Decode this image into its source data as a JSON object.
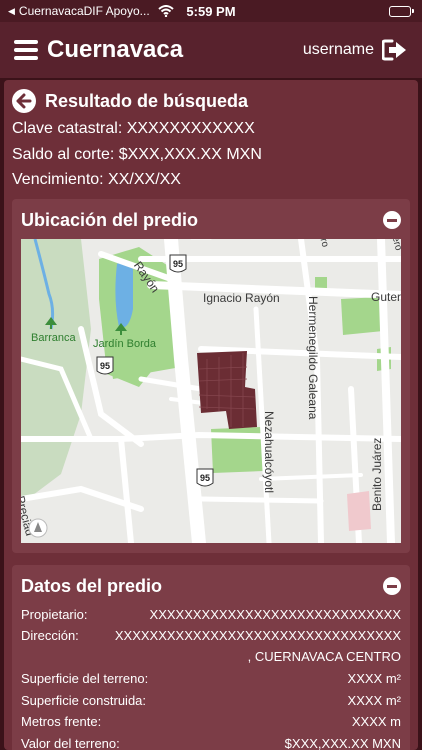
{
  "status_bar": {
    "back_app": "CuernavacaDIF Apoyo...",
    "time": "5:59 PM"
  },
  "header": {
    "title": "Cuernavaca",
    "username": "username"
  },
  "search": {
    "title": "Resultado de búsqueda",
    "clave": "Clave catastral: XXXXXXXXXXXX",
    "saldo": "Saldo al corte: $XXX,XXX.XX MXN",
    "vencimiento": "Vencimiento: XX/XX/XX"
  },
  "ubicacion": {
    "title": "Ubicación del predio",
    "map_labels": {
      "rayon_diag": "Rayón",
      "ignacio": "Ignacio Rayón",
      "guter": "Guter",
      "barranca": "Barranca",
      "jardin": "Jardín Borda",
      "hermenegildo": "Hermenegildo Galeana",
      "nezahualcoyotl": "Nezahualcóyotl",
      "benito": "Benito Juárez",
      "preciad": "Preciad",
      "shield": "95",
      "edge_ro": "ro",
      "edge_ero": "ero"
    }
  },
  "datos": {
    "title": "Datos del predio",
    "propietario_label": "Propietario:",
    "propietario_value": "XXXXXXXXXXXXXXXXXXXXXXXXXXXXX",
    "direccion_label": "Dirección:",
    "direccion_value": "XXXXXXXXXXXXXXXXXXXXXXXXXXXXXXXXX",
    "direccion_line2": ", CUERNAVACA CENTRO",
    "superficie_terreno_label": "Superficie del terreno:",
    "superficie_terreno_value": "XXXX m²",
    "superficie_construida_label": "Superficie construida:",
    "superficie_construida_value": "XXXX m²",
    "metros_frente_label": "Metros frente:",
    "metros_frente_value": "XXXX m",
    "valor_terreno_label": "Valor del terreno:",
    "valor_terreno_value": "$XXX,XXX.XX MXN"
  },
  "colors": {
    "background": "#3b1219",
    "navbar": "#58222d",
    "panel": "#6e2f39",
    "card": "#7c3d47",
    "parcel": "#6b2d34"
  }
}
